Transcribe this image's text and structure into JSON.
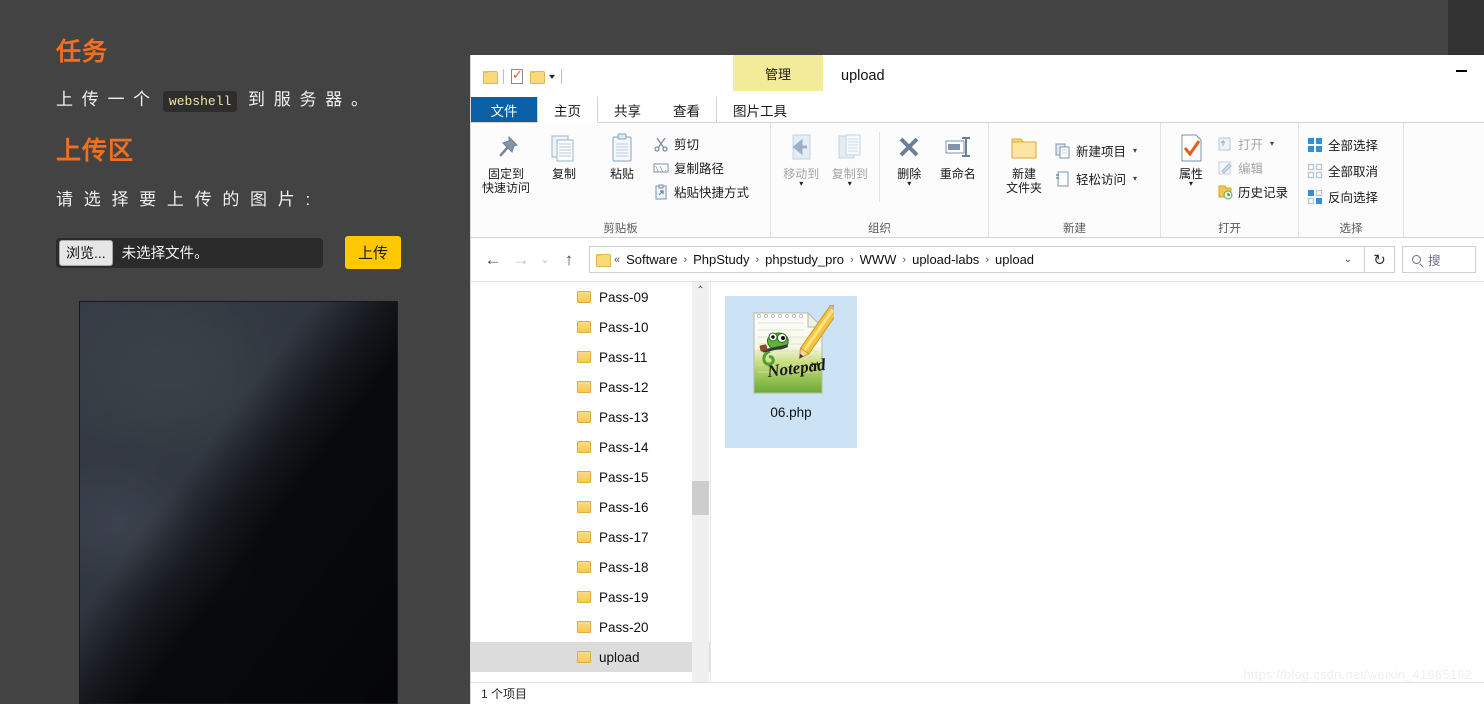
{
  "webpage": {
    "task_heading": "任务",
    "task_text_before": "上 传 一 个 ",
    "task_code": "webshell",
    "task_text_after": " 到 服 务 器 。",
    "upload_heading": "上传区",
    "choose_label": "请 选 择 要 上 传 的 图 片 :",
    "browse_button": "浏览...",
    "file_name_text": "未选择文件。",
    "upload_button": "上传",
    "accent_color": "#f26f21",
    "upload_button_color": "#ffc800",
    "background_color": "#434343"
  },
  "explorer": {
    "window_title": "upload",
    "contextual_tab": "管理",
    "minimize_label": "—",
    "quick_access": [
      {
        "name": "folder-icon"
      },
      {
        "name": "properties-icon"
      },
      {
        "name": "new-folder-icon"
      },
      {
        "name": "chevron-down-icon"
      }
    ],
    "tabs": [
      {
        "id": "file",
        "label": "文件"
      },
      {
        "id": "home",
        "label": "主页"
      },
      {
        "id": "share",
        "label": "共享"
      },
      {
        "id": "view",
        "label": "查看"
      },
      {
        "id": "picture-tools",
        "label": "图片工具"
      }
    ],
    "active_tab": "主页",
    "ribbon_groups": [
      {
        "label": "剪贴板",
        "big_buttons": [
          {
            "label": "固定到\n快速访问",
            "line1": "固定到",
            "line2": "快速访问",
            "icon": "pin-icon",
            "disabled": false
          },
          {
            "label": "复制",
            "line1": "复制",
            "line2": "",
            "icon": "copy-icon",
            "disabled": false
          },
          {
            "label": "粘贴",
            "line1": "粘贴",
            "line2": "",
            "icon": "paste-icon",
            "disabled": false
          }
        ],
        "small_buttons": [
          {
            "label": "剪切",
            "icon": "scissors-icon",
            "disabled": false
          },
          {
            "label": "复制路径",
            "icon": "copy-path-icon",
            "disabled": false
          },
          {
            "label": "粘贴快捷方式",
            "icon": "paste-shortcut-icon",
            "disabled": false
          }
        ]
      },
      {
        "label": "组织",
        "big_buttons": [
          {
            "line1": "移动到",
            "line2": "",
            "icon": "move-to-icon",
            "disabled": true
          },
          {
            "line1": "复制到",
            "line2": "",
            "icon": "copy-to-icon",
            "disabled": true
          },
          {
            "line1": "删除",
            "line2": "",
            "icon": "delete-icon",
            "disabled": false
          },
          {
            "line1": "重命名",
            "line2": "",
            "icon": "rename-icon",
            "disabled": false
          }
        ],
        "small_buttons": []
      },
      {
        "label": "新建",
        "big_buttons": [
          {
            "line1": "新建",
            "line2": "文件夹",
            "icon": "new-folder-icon",
            "disabled": false
          }
        ],
        "small_buttons": [
          {
            "label": "新建项目",
            "icon": "new-item-icon",
            "disabled": false,
            "caret": true
          },
          {
            "label": "轻松访问",
            "icon": "easy-access-icon",
            "disabled": false,
            "caret": true
          }
        ]
      },
      {
        "label": "打开",
        "big_buttons": [
          {
            "line1": "属性",
            "line2": "",
            "icon": "properties-icon",
            "disabled": false
          }
        ],
        "small_buttons": [
          {
            "label": "打开",
            "icon": "open-icon",
            "disabled": true,
            "caret": true
          },
          {
            "label": "编辑",
            "icon": "edit-icon",
            "disabled": true
          },
          {
            "label": "历史记录",
            "icon": "history-icon",
            "disabled": false
          }
        ]
      },
      {
        "label": "选择",
        "big_buttons": [],
        "small_buttons": [
          {
            "label": "全部选择",
            "icon": "select-all-icon",
            "disabled": false
          },
          {
            "label": "全部取消",
            "icon": "select-none-icon",
            "disabled": false
          },
          {
            "label": "反向选择",
            "icon": "invert-selection-icon",
            "disabled": false
          }
        ]
      }
    ],
    "address_bar": {
      "back_icon": "←",
      "forward_icon": "→",
      "recent_icon": "⌄",
      "up_icon": "↑",
      "prefix": "«",
      "crumbs": [
        "Software",
        "PhpStudy",
        "phpstudy_pro",
        "WWW",
        "upload-labs",
        "upload"
      ],
      "separator": "›",
      "dropdown_icon": "⌄",
      "refresh_icon": "↻"
    },
    "search": {
      "placeholder": "搜",
      "icon": "search-icon"
    },
    "tree_items": [
      {
        "label": "Pass-09",
        "selected": false
      },
      {
        "label": "Pass-10",
        "selected": false
      },
      {
        "label": "Pass-11",
        "selected": false
      },
      {
        "label": "Pass-12",
        "selected": false
      },
      {
        "label": "Pass-13",
        "selected": false
      },
      {
        "label": "Pass-14",
        "selected": false
      },
      {
        "label": "Pass-15",
        "selected": false
      },
      {
        "label": "Pass-16",
        "selected": false
      },
      {
        "label": "Pass-17",
        "selected": false
      },
      {
        "label": "Pass-18",
        "selected": false
      },
      {
        "label": "Pass-19",
        "selected": false
      },
      {
        "label": "Pass-20",
        "selected": false
      },
      {
        "label": "upload",
        "selected": true
      }
    ],
    "scrollbar": {
      "up_icon": "⌃",
      "down_icon": "⌄"
    },
    "files": [
      {
        "name": "06.php",
        "icon": "notepad-plus-plus-file-icon",
        "selected": true
      }
    ],
    "statusbar_text": "1 个项目"
  },
  "watermark": "https://blog.csdn.net/weixin_41665162"
}
